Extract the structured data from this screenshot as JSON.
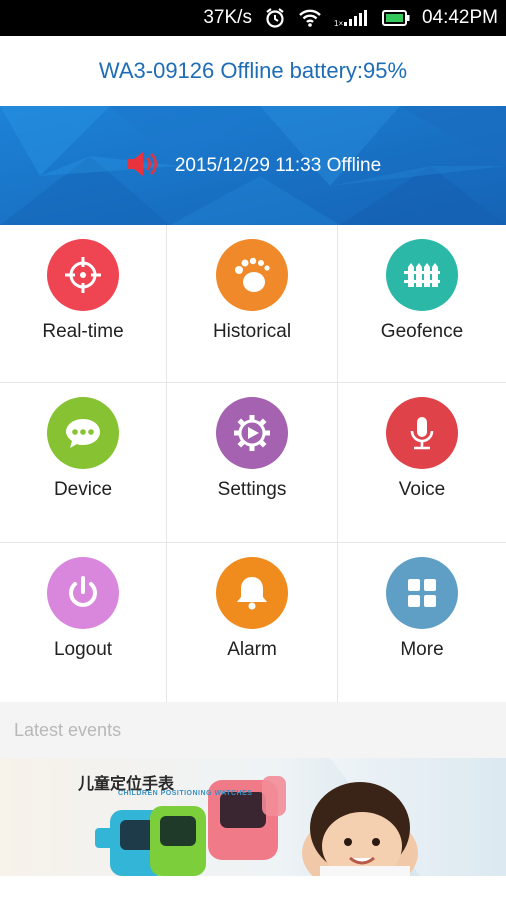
{
  "status_bar": {
    "speed": "37K/s",
    "time": "04:42PM",
    "icons": [
      "alarm-clock-icon",
      "wifi-icon",
      "signal-icon",
      "battery-icon"
    ]
  },
  "header": {
    "title": "WA3-09126 Offline battery:95%"
  },
  "banner": {
    "status_text": "2015/12/29 11:33 Offline",
    "icon": "speaker-icon"
  },
  "menu": {
    "items": [
      {
        "label": "Real-time",
        "icon": "crosshair-icon",
        "color": "#ef4451"
      },
      {
        "label": "Historical",
        "icon": "footprint-icon",
        "color": "#f0892a"
      },
      {
        "label": "Geofence",
        "icon": "fence-icon",
        "color": "#2bb8a6"
      },
      {
        "label": "Device",
        "icon": "chat-bubble-icon",
        "color": "#86c232"
      },
      {
        "label": "Settings",
        "icon": "gear-icon",
        "color": "#a462b0"
      },
      {
        "label": "Voice",
        "icon": "microphone-icon",
        "color": "#e0424a"
      },
      {
        "label": "Logout",
        "icon": "power-icon",
        "color": "#d987dd"
      },
      {
        "label": "Alarm",
        "icon": "bell-icon",
        "color": "#f08b1e"
      },
      {
        "label": "More",
        "icon": "grid-icon",
        "color": "#5f9fc6"
      }
    ]
  },
  "events": {
    "label": "Latest events"
  },
  "ad": {
    "title": "儿童定位手表",
    "subtitle": "CHILDREN POSITIONING WATCHES"
  }
}
